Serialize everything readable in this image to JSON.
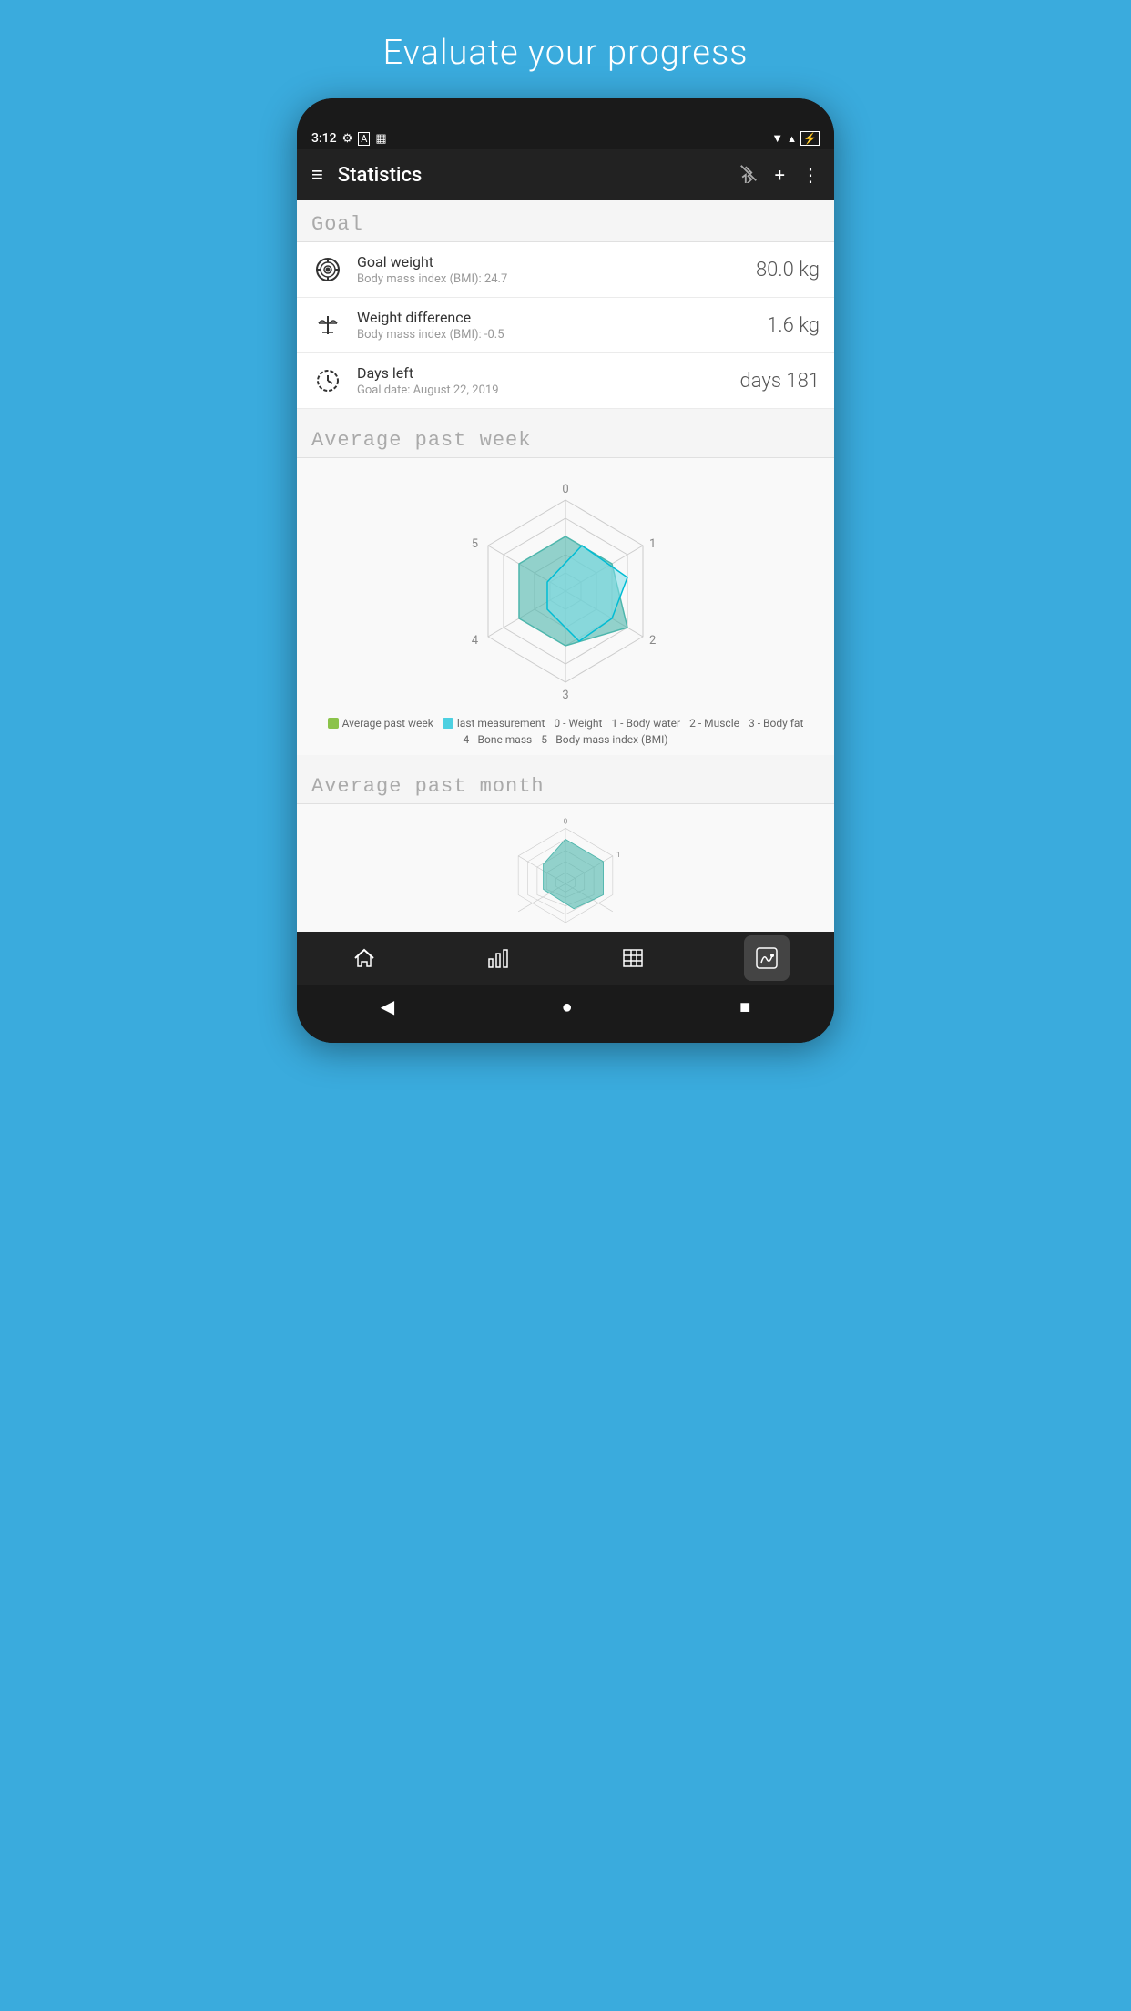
{
  "page": {
    "title": "Evaluate your progress"
  },
  "statusBar": {
    "time": "3:12",
    "icons": [
      "settings",
      "A",
      "battery-low"
    ]
  },
  "toolbar": {
    "title": "Statistics",
    "bluetoothDisabled": true,
    "addLabel": "+",
    "moreLabel": "⋮"
  },
  "goalSection": {
    "header": "Goal",
    "items": [
      {
        "id": "goal-weight",
        "label": "Goal weight",
        "sublabel": "Body mass index (BMI): 24.7",
        "value": "80.0 kg"
      },
      {
        "id": "weight-difference",
        "label": "Weight difference",
        "sublabel": "Body mass index (BMI): -0.5",
        "value": "1.6 kg"
      },
      {
        "id": "days-left",
        "label": "Days left",
        "sublabel": "Goal date: August 22, 2019",
        "value": "days 181"
      }
    ]
  },
  "chart1": {
    "header": "Average past week",
    "labels": [
      "0",
      "1",
      "2",
      "3",
      "4",
      "5"
    ],
    "legend": [
      {
        "color": "#8bc34a",
        "label": "Average past week"
      },
      {
        "color": "#4dd0e1",
        "label": "last measurement"
      },
      {
        "label": "0 - Weight"
      },
      {
        "label": "1 - Body water"
      },
      {
        "label": "2 - Muscle"
      },
      {
        "label": "3 - Body fat"
      },
      {
        "label": "4 - Bone mass"
      },
      {
        "label": "5 - Body mass index (BMI)"
      }
    ]
  },
  "chart2": {
    "header": "Average past month"
  },
  "bottomNav": [
    {
      "id": "home",
      "label": "home",
      "icon": "🏠",
      "active": false
    },
    {
      "id": "chart",
      "label": "chart",
      "icon": "📊",
      "active": false
    },
    {
      "id": "table",
      "label": "table",
      "icon": "📋",
      "active": false
    },
    {
      "id": "stats",
      "label": "stats",
      "icon": "📉",
      "active": true
    }
  ],
  "androidNav": {
    "back": "◀",
    "home": "●",
    "recent": "■"
  }
}
